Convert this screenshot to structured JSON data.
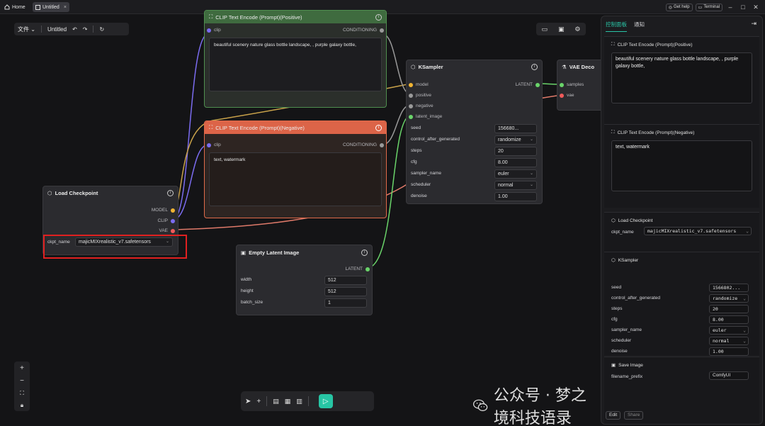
{
  "titlebar": {
    "home_label": "Home",
    "tab_label": "Untitled",
    "tab_close": "×",
    "get_help": "Get help",
    "terminal": "Terminal"
  },
  "topmenu": {
    "file": "文件",
    "workflow": "Untitled"
  },
  "nodes": {
    "clip_positive": {
      "title": "CLIP Text Encode (Prompt)(Positive)",
      "input_clip": "clip",
      "output": "CONDITIONING",
      "text": "beautiful scenery nature glass bottle landscape, , purple galaxy bottle,"
    },
    "clip_negative": {
      "title": "CLIP Text Encode (Prompt)(Negative)",
      "input_clip": "clip",
      "output": "CONDITIONING",
      "text": "text, watermark"
    },
    "load_checkpoint": {
      "title": "Load Checkpoint",
      "out_model": "MODEL",
      "out_clip": "CLIP",
      "out_vae": "VAE",
      "ckpt_label": "ckpt_name",
      "ckpt_value": "majicMIXrealistic_v7.safetensors"
    },
    "ksampler": {
      "title": "KSampler",
      "in_model": "model",
      "in_positive": "positive",
      "in_negative": "negative",
      "in_latent": "latent_image",
      "out_latent": "LATENT",
      "widgets": [
        {
          "label": "seed",
          "value": "156680...",
          "dropdown": false
        },
        {
          "label": "control_after_generated",
          "value": "randomize",
          "dropdown": true
        },
        {
          "label": "steps",
          "value": "20",
          "dropdown": false
        },
        {
          "label": "cfg",
          "value": "8.00",
          "dropdown": false
        },
        {
          "label": "sampler_name",
          "value": "euler",
          "dropdown": true
        },
        {
          "label": "scheduler",
          "value": "normal",
          "dropdown": true
        },
        {
          "label": "denoise",
          "value": "1.00",
          "dropdown": false
        }
      ]
    },
    "vae_decode": {
      "title": "VAE Deco",
      "in_samples": "samples",
      "in_vae": "vae"
    },
    "empty_latent": {
      "title": "Empty Latent Image",
      "out_latent": "LATENT",
      "widgets": [
        {
          "label": "width",
          "value": "512"
        },
        {
          "label": "height",
          "value": "512"
        },
        {
          "label": "batch_size",
          "value": "1"
        }
      ]
    }
  },
  "panel": {
    "tab_control": "控制面板",
    "tab_notify": "通知",
    "pos_title": "CLIP Text Encode (Prompt)(Positive)",
    "pos_text": "beautiful scenery nature glass bottle landscape, , purple galaxy bottle,",
    "neg_title": "CLIP Text Encode (Prompt)(Negative)",
    "neg_text": "text, watermark",
    "ckpt_title": "Load Checkpoint",
    "ckpt_label": "ckpt_name",
    "ckpt_value": "majicMIXrealistic_v7.safetensors",
    "ks_title": "KSampler",
    "ks_rows": [
      {
        "label": "seed",
        "value": "1566802...",
        "dropdown": false
      },
      {
        "label": "control_after_generated",
        "value": "randomize",
        "dropdown": true
      },
      {
        "label": "steps",
        "value": "20",
        "dropdown": false
      },
      {
        "label": "cfg",
        "value": "8.00",
        "dropdown": false
      },
      {
        "label": "sampler_name",
        "value": "euler",
        "dropdown": true
      },
      {
        "label": "scheduler",
        "value": "normal",
        "dropdown": true
      },
      {
        "label": "denoise",
        "value": "1.00",
        "dropdown": false
      }
    ],
    "save_title": "Save Image",
    "save_label": "filename_prefix",
    "save_value": "ComfyUI",
    "edit": "Edit",
    "share": "Share"
  },
  "watermark": "公众号 · 梦之境科技语录",
  "colors": {
    "accent": "#29c4a6",
    "positive_node": "#4a8a4a",
    "negative_node": "#e06a4a",
    "clip_port": "#7b6cf0",
    "model_port": "#f0b432",
    "vae_port": "#f05a5a",
    "latent_port": "#6ad46a",
    "conditioning_port": "#9a9a9a",
    "highlight": "#e02020"
  }
}
